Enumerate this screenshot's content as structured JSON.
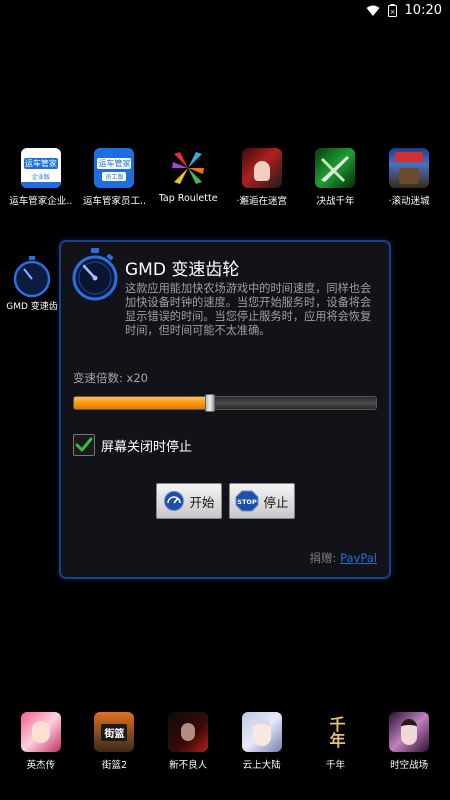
{
  "status_bar": {
    "time": "10:20"
  },
  "top_apps": [
    {
      "label": "运车管家企业..",
      "icon": "yunche-enterprise-icon",
      "title": "运车管家",
      "badge": "企业版"
    },
    {
      "label": "运车管家员工..",
      "icon": "yunche-employee-icon",
      "title": "运车管家",
      "badge": "员工版"
    },
    {
      "label": "Tap Roulette",
      "icon": "tap-roulette-icon"
    },
    {
      "label": "·邂逅在迷宫",
      "icon": "maze-encounter-icon"
    },
    {
      "label": "决战千年",
      "icon": "battle-millennium-icon"
    },
    {
      "label": "·滚动迷城",
      "icon": "rolling-city-icon"
    }
  ],
  "background_app": {
    "label": "GMD 变速齿",
    "icon": "stopwatch-icon"
  },
  "dialog": {
    "title": "GMD 变速齿轮",
    "description": "这款应用能加快农场游戏中的时间速度，同样也会加快设备时钟的速度。当您开始服务时，设备将会显示错误的时间。当您停止服务时，应用将会恢复时间，但时间可能不太准确。",
    "multiplier_label": "变速倍数: x20",
    "slider_level": 0.45,
    "checkbox_label": "屏幕关闭时停止",
    "checkbox_checked": true,
    "start_label": "开始",
    "stop_label": "停止",
    "stop_icon_text": "STOP",
    "donate_label": "捐赠:",
    "paypal_label": "PayPal"
  },
  "bottom_apps": [
    {
      "label": "英杰传",
      "icon": "heroes-legend-icon"
    },
    {
      "label": "街篮2",
      "icon": "street-basketball-icon",
      "badge": "街篮"
    },
    {
      "label": "新不良人",
      "icon": "new-buliangren-icon"
    },
    {
      "label": "云上大陆",
      "icon": "cloud-continent-icon"
    },
    {
      "label": "千年",
      "icon": "millennium-icon",
      "badge": "千年"
    },
    {
      "label": "时空战场",
      "icon": "spacetime-battlefield-icon"
    }
  ],
  "colors": {
    "accent_blue": "#1c3f8a",
    "slider_orange": "#ff9a10",
    "check_green": "#3fb84a",
    "paypal": "#2e6bd4"
  }
}
